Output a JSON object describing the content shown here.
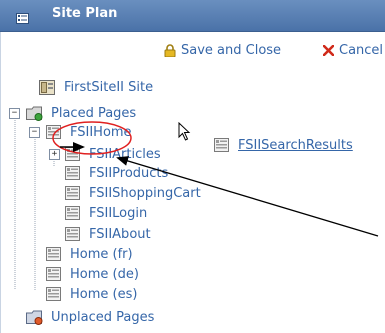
{
  "window": {
    "title": "Site Plan"
  },
  "toolbar": {
    "save_close": "Save and Close",
    "cancel": "Cancel"
  },
  "tree": {
    "site": "FirstSiteII Site",
    "placed": "Placed Pages",
    "fsii_home": "FSIIHome",
    "search_results": "FSIISearchResults",
    "articles": "FSIIArticles",
    "products": "FSIIProducts",
    "cart": "FSIIShoppingCart",
    "login": "FSIILogin",
    "about": "FSIIAbout",
    "home_fr": "Home (fr)",
    "home_de": "Home (de)",
    "home_es": "Home (es)",
    "unplaced": "Unplaced Pages"
  },
  "colors": {
    "link": "#3566a8",
    "titlebar": "#5579ad",
    "annotation_red": "#e02020"
  },
  "icons": {
    "title": "tree-list-icon",
    "save": "padlock-icon",
    "cancel": "red-x-icon",
    "page": "page-template-icon",
    "folder": "folder-icon",
    "site": "site-icon"
  }
}
